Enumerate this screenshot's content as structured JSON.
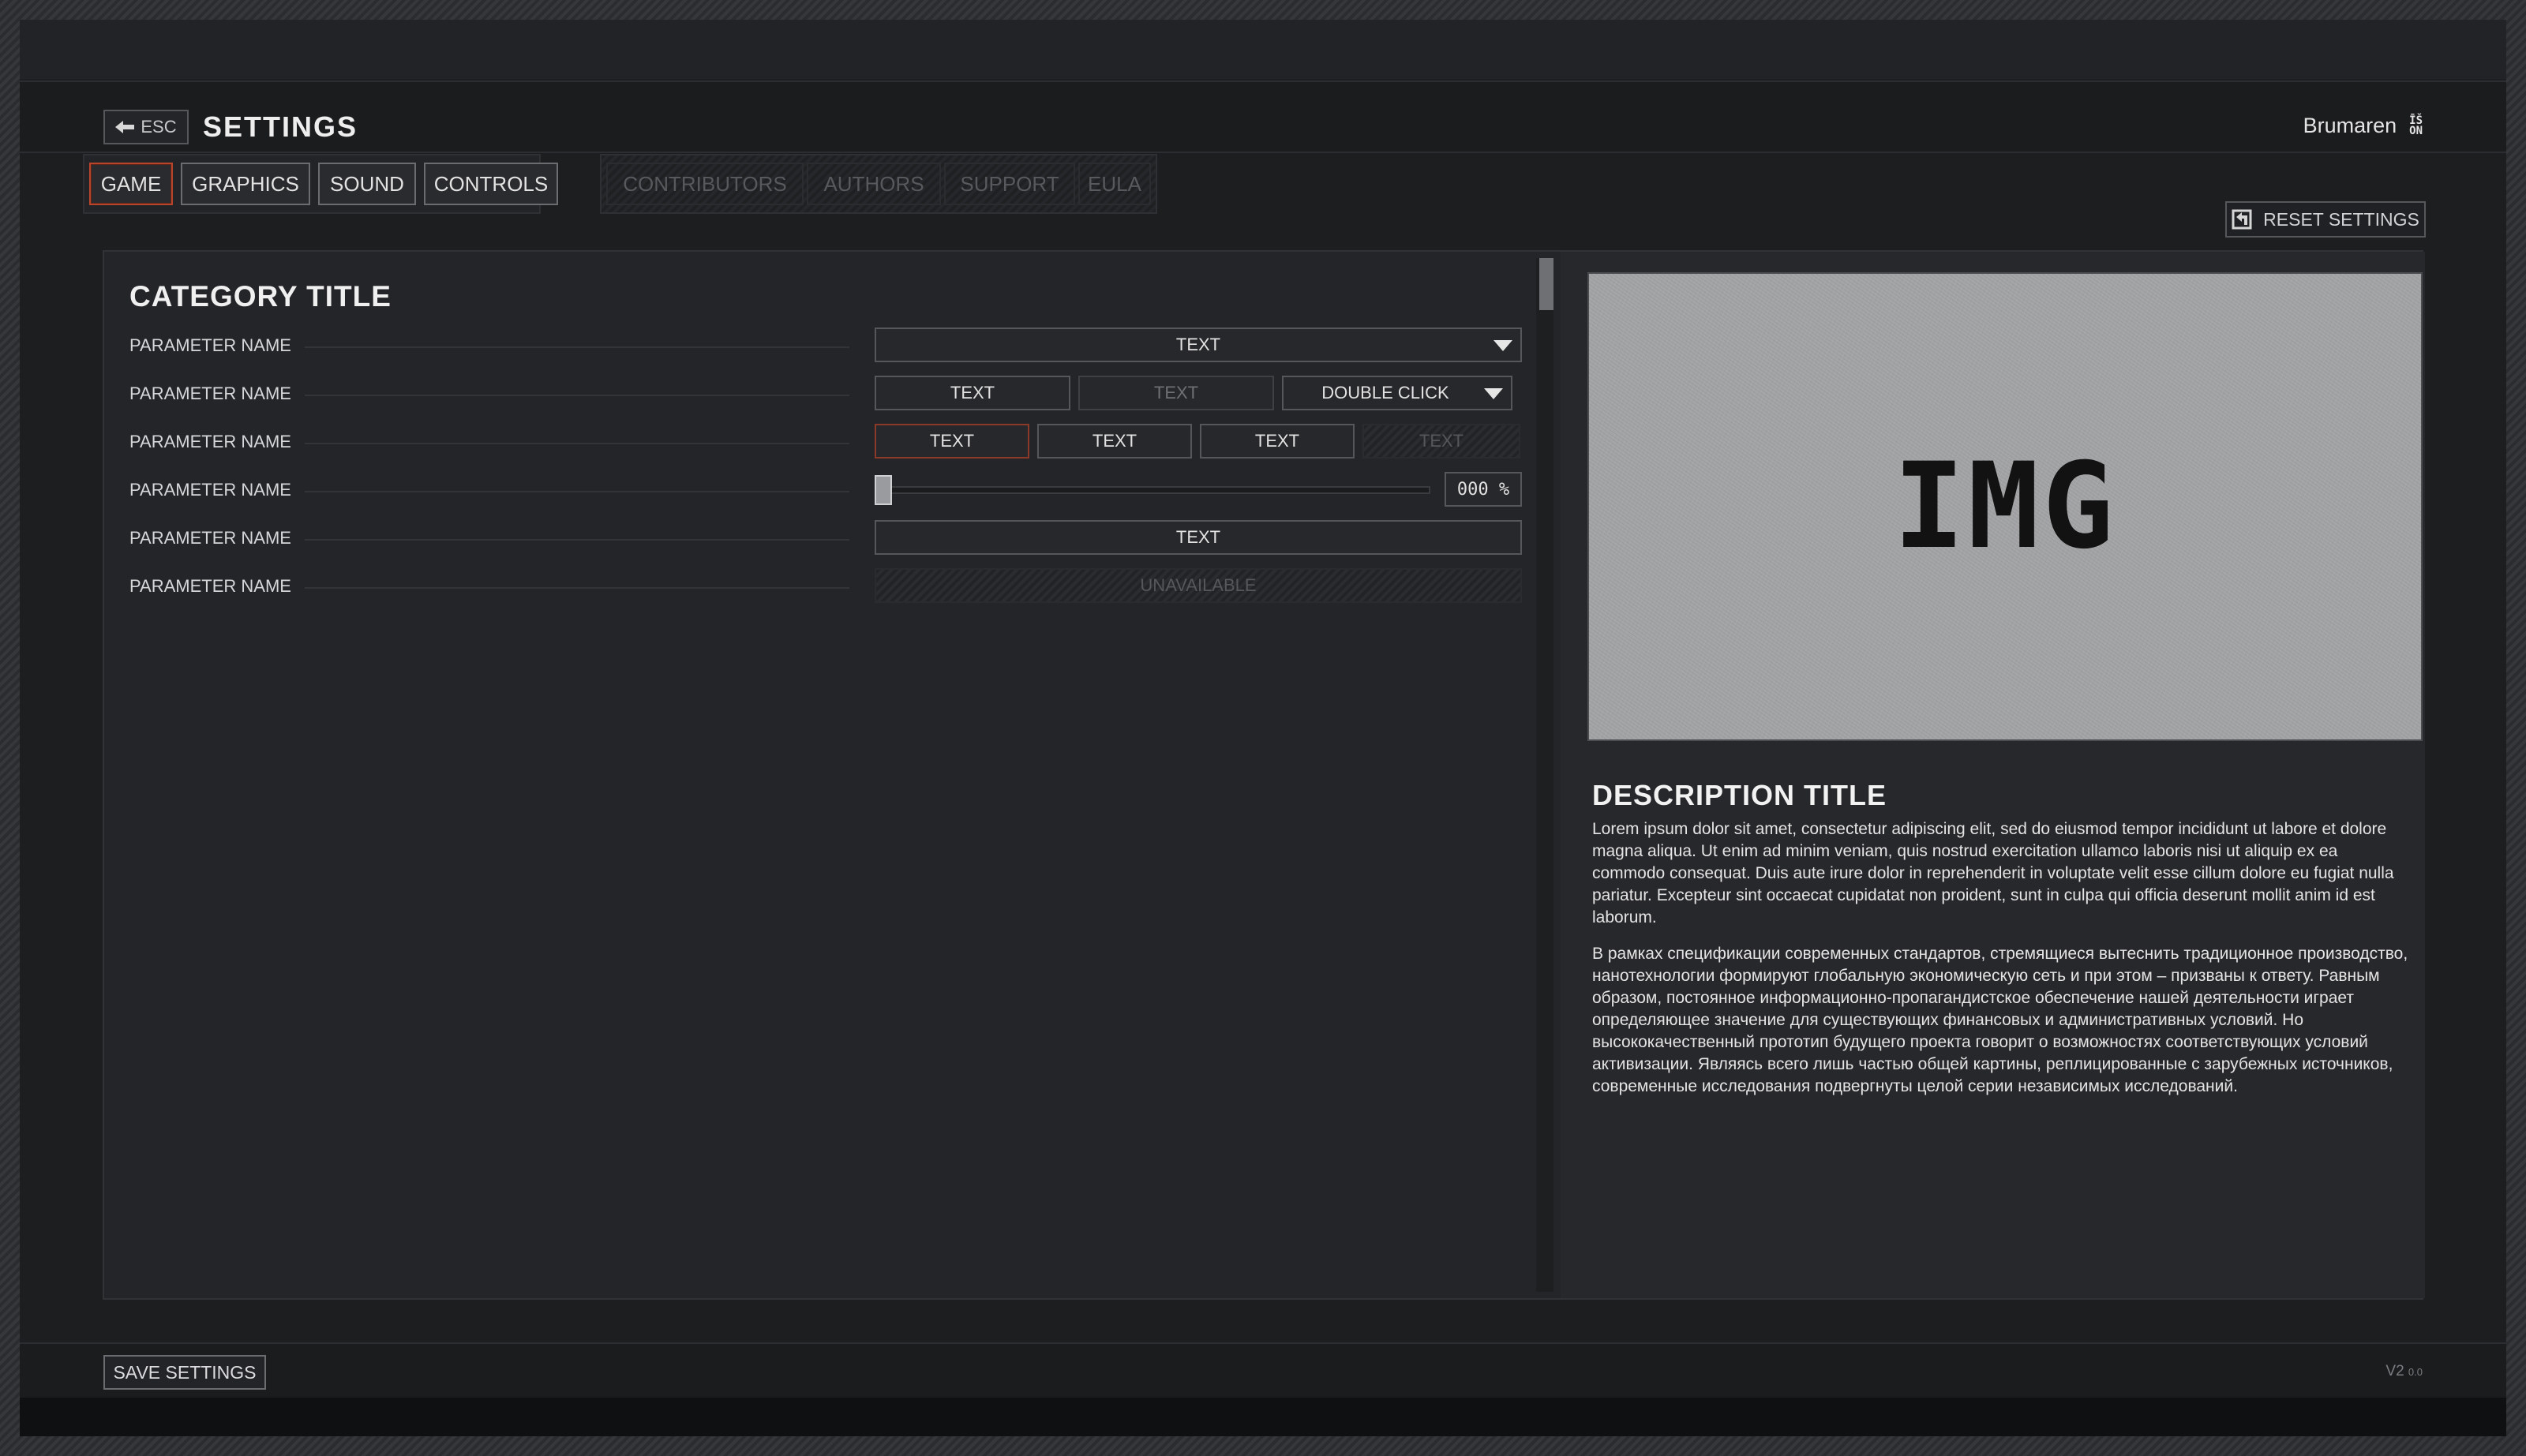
{
  "header": {
    "esc_label": "ESC",
    "title": "SETTINGS",
    "username": "Brumaren",
    "lang_icon_top": "ĪŠ",
    "lang_icon_bottom": "ON"
  },
  "tabs": {
    "main": [
      {
        "label": "GAME",
        "active": true
      },
      {
        "label": "GRAPHICS",
        "active": false
      },
      {
        "label": "SOUND",
        "active": false
      },
      {
        "label": "CONTROLS",
        "active": false
      }
    ],
    "aux": [
      {
        "label": "CONTRIBUTORS"
      },
      {
        "label": "AUTHORS"
      },
      {
        "label": "SUPPORT"
      },
      {
        "label": "EULA"
      }
    ]
  },
  "reset_label": "RESET SETTINGS",
  "category": {
    "title": "CATEGORY TITLE",
    "rows": [
      {
        "name": "PARAMETER NAME",
        "dropdown_value": "TEXT"
      },
      {
        "name": "PARAMETER NAME",
        "opt1": "TEXT",
        "opt2": "TEXT",
        "dropdown_value": "DOUBLE CLICK"
      },
      {
        "name": "PARAMETER NAME",
        "opt1": "TEXT",
        "opt2": "TEXT",
        "opt3": "TEXT",
        "opt4": "TEXT"
      },
      {
        "name": "PARAMETER NAME",
        "slider_value": 0,
        "slider_readout": "000 %"
      },
      {
        "name": "PARAMETER NAME",
        "button_label": "TEXT"
      },
      {
        "name": "PARAMETER NAME",
        "unavailable_label": "UNAVAILABLE"
      }
    ]
  },
  "preview": {
    "image_label": "IMG",
    "title": "DESCRIPTION TITLE",
    "paragraph_1": "Lorem ipsum dolor sit amet, consectetur adipiscing elit, sed do eiusmod tempor incididunt ut labore et dolore magna aliqua. Ut enim ad minim veniam, quis nostrud exercitation ullamco laboris nisi ut aliquip ex ea commodo consequat. Duis aute irure dolor in reprehenderit in voluptate velit esse cillum dolore eu fugiat nulla pariatur. Excepteur sint occaecat cupidatat non proident, sunt in culpa qui officia deserunt mollit anim id est laborum.",
    "paragraph_2": "В рамках спецификации современных стандартов, стремящиеся вытеснить традиционное производство, нанотехнологии формируют глобальную экономическую сеть и при этом – призваны к ответу. Равным образом, постоянное информационно-пропагандистское обеспечение нашей деятельности играет определяющее значение для существующих финансовых и административных условий. Но высококачественный прототип будущего проекта говорит о возможностях соответствующих условий активизации. Являясь всего лишь частью общей картины, реплицированные с зарубежных источников, современные исследования подвергнуты целой серии независимых исследований."
  },
  "footer": {
    "save_label": "SAVE SETTINGS",
    "version_major": "V2",
    "version_minor": "0.0"
  }
}
